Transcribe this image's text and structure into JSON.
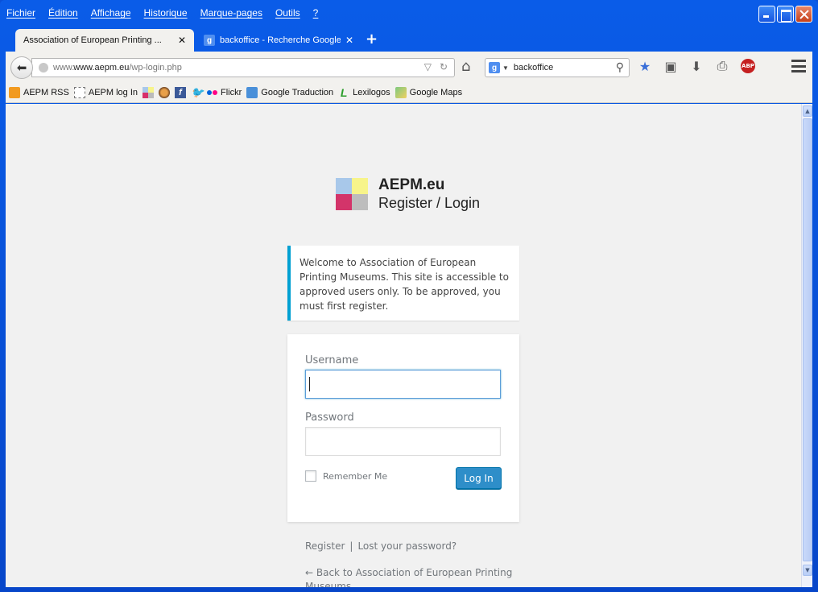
{
  "menu": [
    "Fichier",
    "Édition",
    "Affichage",
    "Historique",
    "Marque-pages",
    "Outils",
    "?"
  ],
  "tabs": [
    {
      "title": "Association of European Printing ...",
      "close": "✕"
    },
    {
      "title": "backoffice - Recherche Google",
      "close": "✕"
    }
  ],
  "new_tab": "+",
  "address": {
    "domain": "www.aepm.eu",
    "path": "/wp-login.php",
    "prefix": "www."
  },
  "search": {
    "value": "backoffice",
    "engine_letter": "g"
  },
  "bookmarks": [
    {
      "label": "AEPM RSS",
      "icon": "rss-icon"
    },
    {
      "label": "AEPM log In",
      "icon": "dashed-page-icon"
    },
    {
      "label": "",
      "icon": "aepm-logo-icon"
    },
    {
      "label": "",
      "icon": "mail-icon"
    },
    {
      "label": "",
      "icon": "facebook-icon"
    },
    {
      "label": "",
      "icon": "twitter-icon"
    },
    {
      "label": "Flickr",
      "icon": "flickr-icon"
    },
    {
      "label": "Google Traduction",
      "icon": "translate-icon"
    },
    {
      "label": "Lexilogos",
      "icon": "lexilogos-icon"
    },
    {
      "label": "Google Maps",
      "icon": "maps-icon"
    }
  ],
  "login": {
    "logo_title": "AEPM.eu",
    "logo_subtitle": "Register / Login",
    "message": "Welcome to Association of European Printing Museums. This site is accessible to approved users only. To be approved, you must first register.",
    "username_label": "Username",
    "username_value": "",
    "password_label": "Password",
    "password_value": "",
    "remember_label": "Remember Me",
    "login_button": "Log In",
    "register_link": "Register",
    "separator": "|",
    "lost_password_link": "Lost your password?",
    "back_link": "← Back to Association of European Printing Museums"
  },
  "colors": {
    "accent": "#00a0d2",
    "button": "#2e8ec9",
    "window_blue": "#0a5ce8"
  }
}
